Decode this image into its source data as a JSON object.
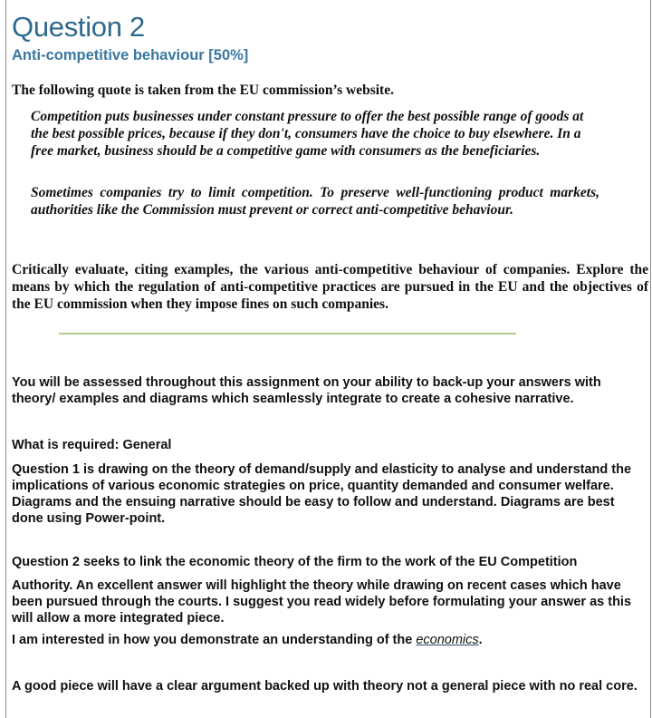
{
  "header": {
    "title": "Question 2",
    "subtitle": "Anti-competitive behaviour  [50%]"
  },
  "intro": "The following quote is taken from the EU commission’s website.",
  "quotes": [
    "Competition puts businesses under constant pressure to offer the best possible range of goods at the best possible prices, because if they don't, consumers have the choice to buy elsewhere. In a free market, business should be a competitive game with consumers as the beneficiaries.",
    "Sometimes companies try to limit competition. To preserve well-functioning product markets, authorities like the Commission must prevent or correct anti-competitive behaviour."
  ],
  "task": "Critically evaluate, citing  examples, the various anti-competitive behaviour of companies. Explore the means by which the regulation of anti-competitive practices are pursued in the EU and the objectives of the EU commission  when they impose fines on such companies.",
  "guidance": {
    "assessment": "You will be assessed throughout this assignment  on your ability to back-up your answers with theory/ examples and diagrams which seamlessly integrate to create a cohesive narrative.",
    "required_heading": "What is required: General",
    "question1": "Question 1 is drawing on the theory of demand/supply and elasticity to analyse and understand the implications of various economic strategies on price, quantity demanded and consumer welfare. Diagrams and the ensuing narrative should be easy to follow and understand. Diagrams are best done using Power-point.",
    "question2_line1": "Question 2 seeks to link the economic theory of the firm to the work of the EU Competition",
    "question2_rest": "Authority. An excellent answer will highlight the theory while drawing on recent cases which have been pursued through the courts. I suggest you read widely before formulating your answer as this will allow a more integrated piece.",
    "interest_prefix": "I am interested in how you demonstrate an understanding of the ",
    "interest_link": "economics",
    "interest_suffix": ".",
    "good_piece": "A good piece will have a clear argument backed up with theory not a general piece with no real core."
  }
}
